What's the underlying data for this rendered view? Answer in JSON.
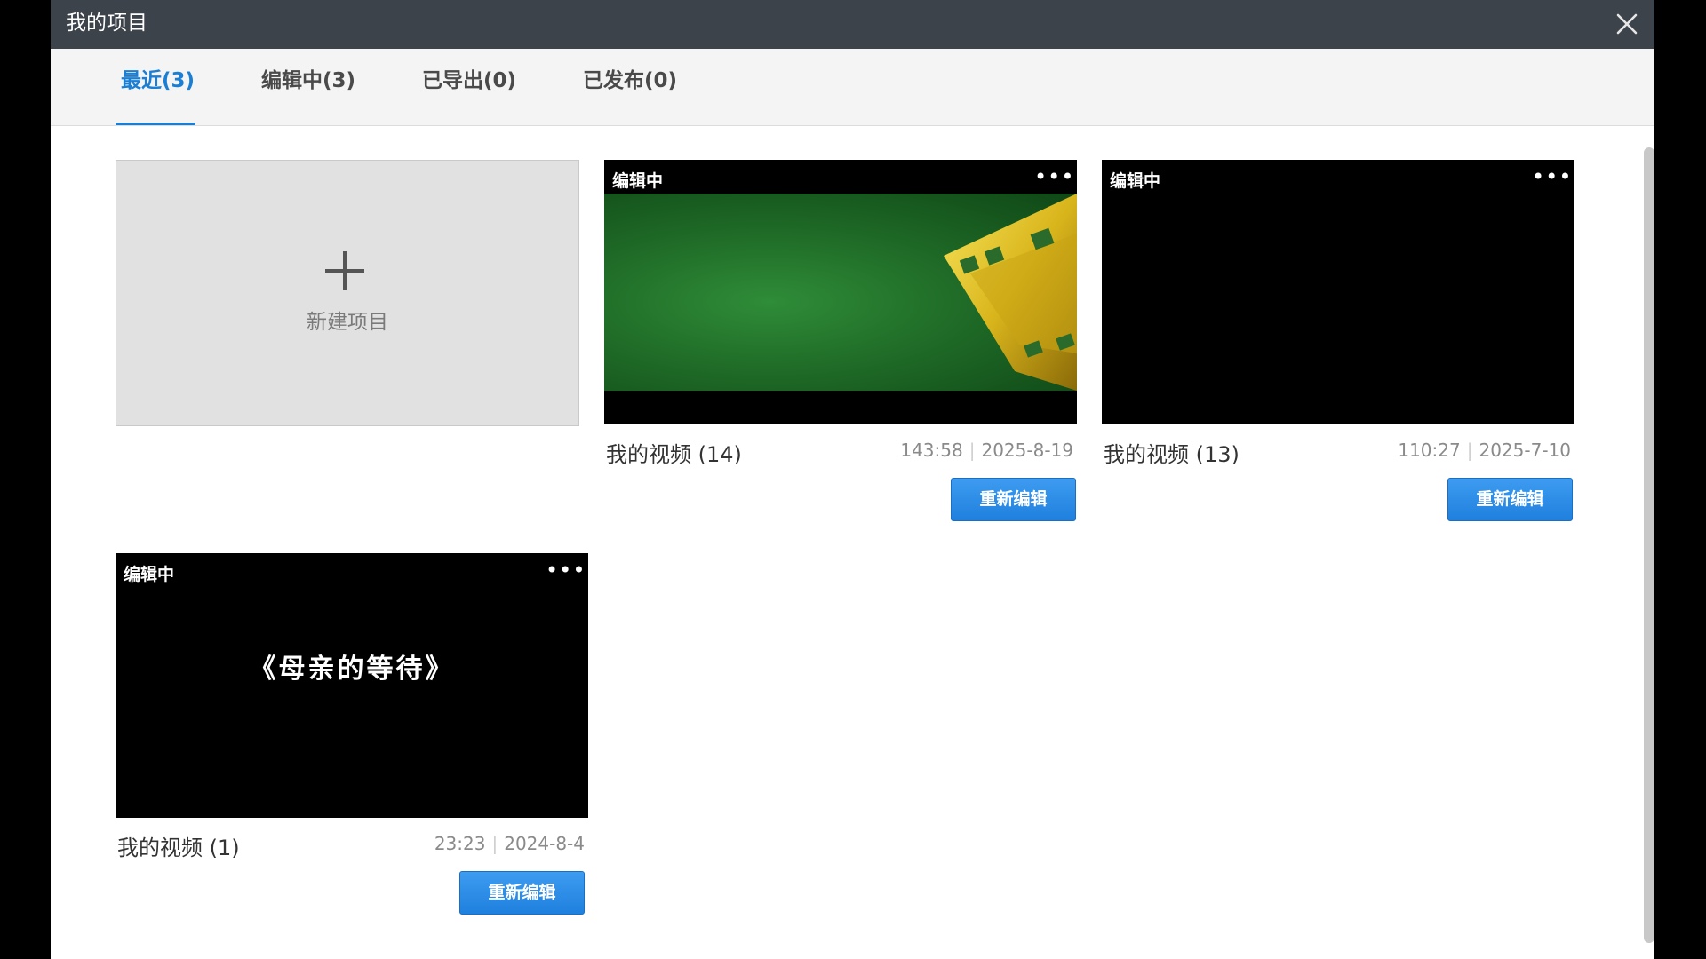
{
  "window": {
    "title": "我的项目"
  },
  "tabs": [
    {
      "label": "最近(3)",
      "active": true
    },
    {
      "label": "编辑中(3)",
      "active": false
    },
    {
      "label": "已导出(0)",
      "active": false
    },
    {
      "label": "已发布(0)",
      "active": false
    }
  ],
  "new_project": {
    "label": "新建项目"
  },
  "projects": [
    {
      "status": "编辑中",
      "name": "我的视频 (14)",
      "duration": "143:58",
      "date": "2025-8-19",
      "action": "重新编辑",
      "thumbnail": "green-film-reel"
    },
    {
      "status": "编辑中",
      "name": "我的视频 (13)",
      "duration": "110:27",
      "date": "2025-7-10",
      "action": "重新编辑",
      "thumbnail": "black"
    },
    {
      "status": "编辑中",
      "name": "我的视频 (1)",
      "duration": "23:23",
      "date": "2024-8-4",
      "action": "重新编辑",
      "thumbnail": "black-title",
      "thumb_text": "《母亲的等待》"
    }
  ],
  "colors": {
    "accent": "#1a7fd4",
    "titlebar": "#3d434b",
    "button": "#2a8ae6"
  },
  "icons": {
    "close": "close-icon",
    "more": "more-icon",
    "plus": "plus-icon"
  }
}
